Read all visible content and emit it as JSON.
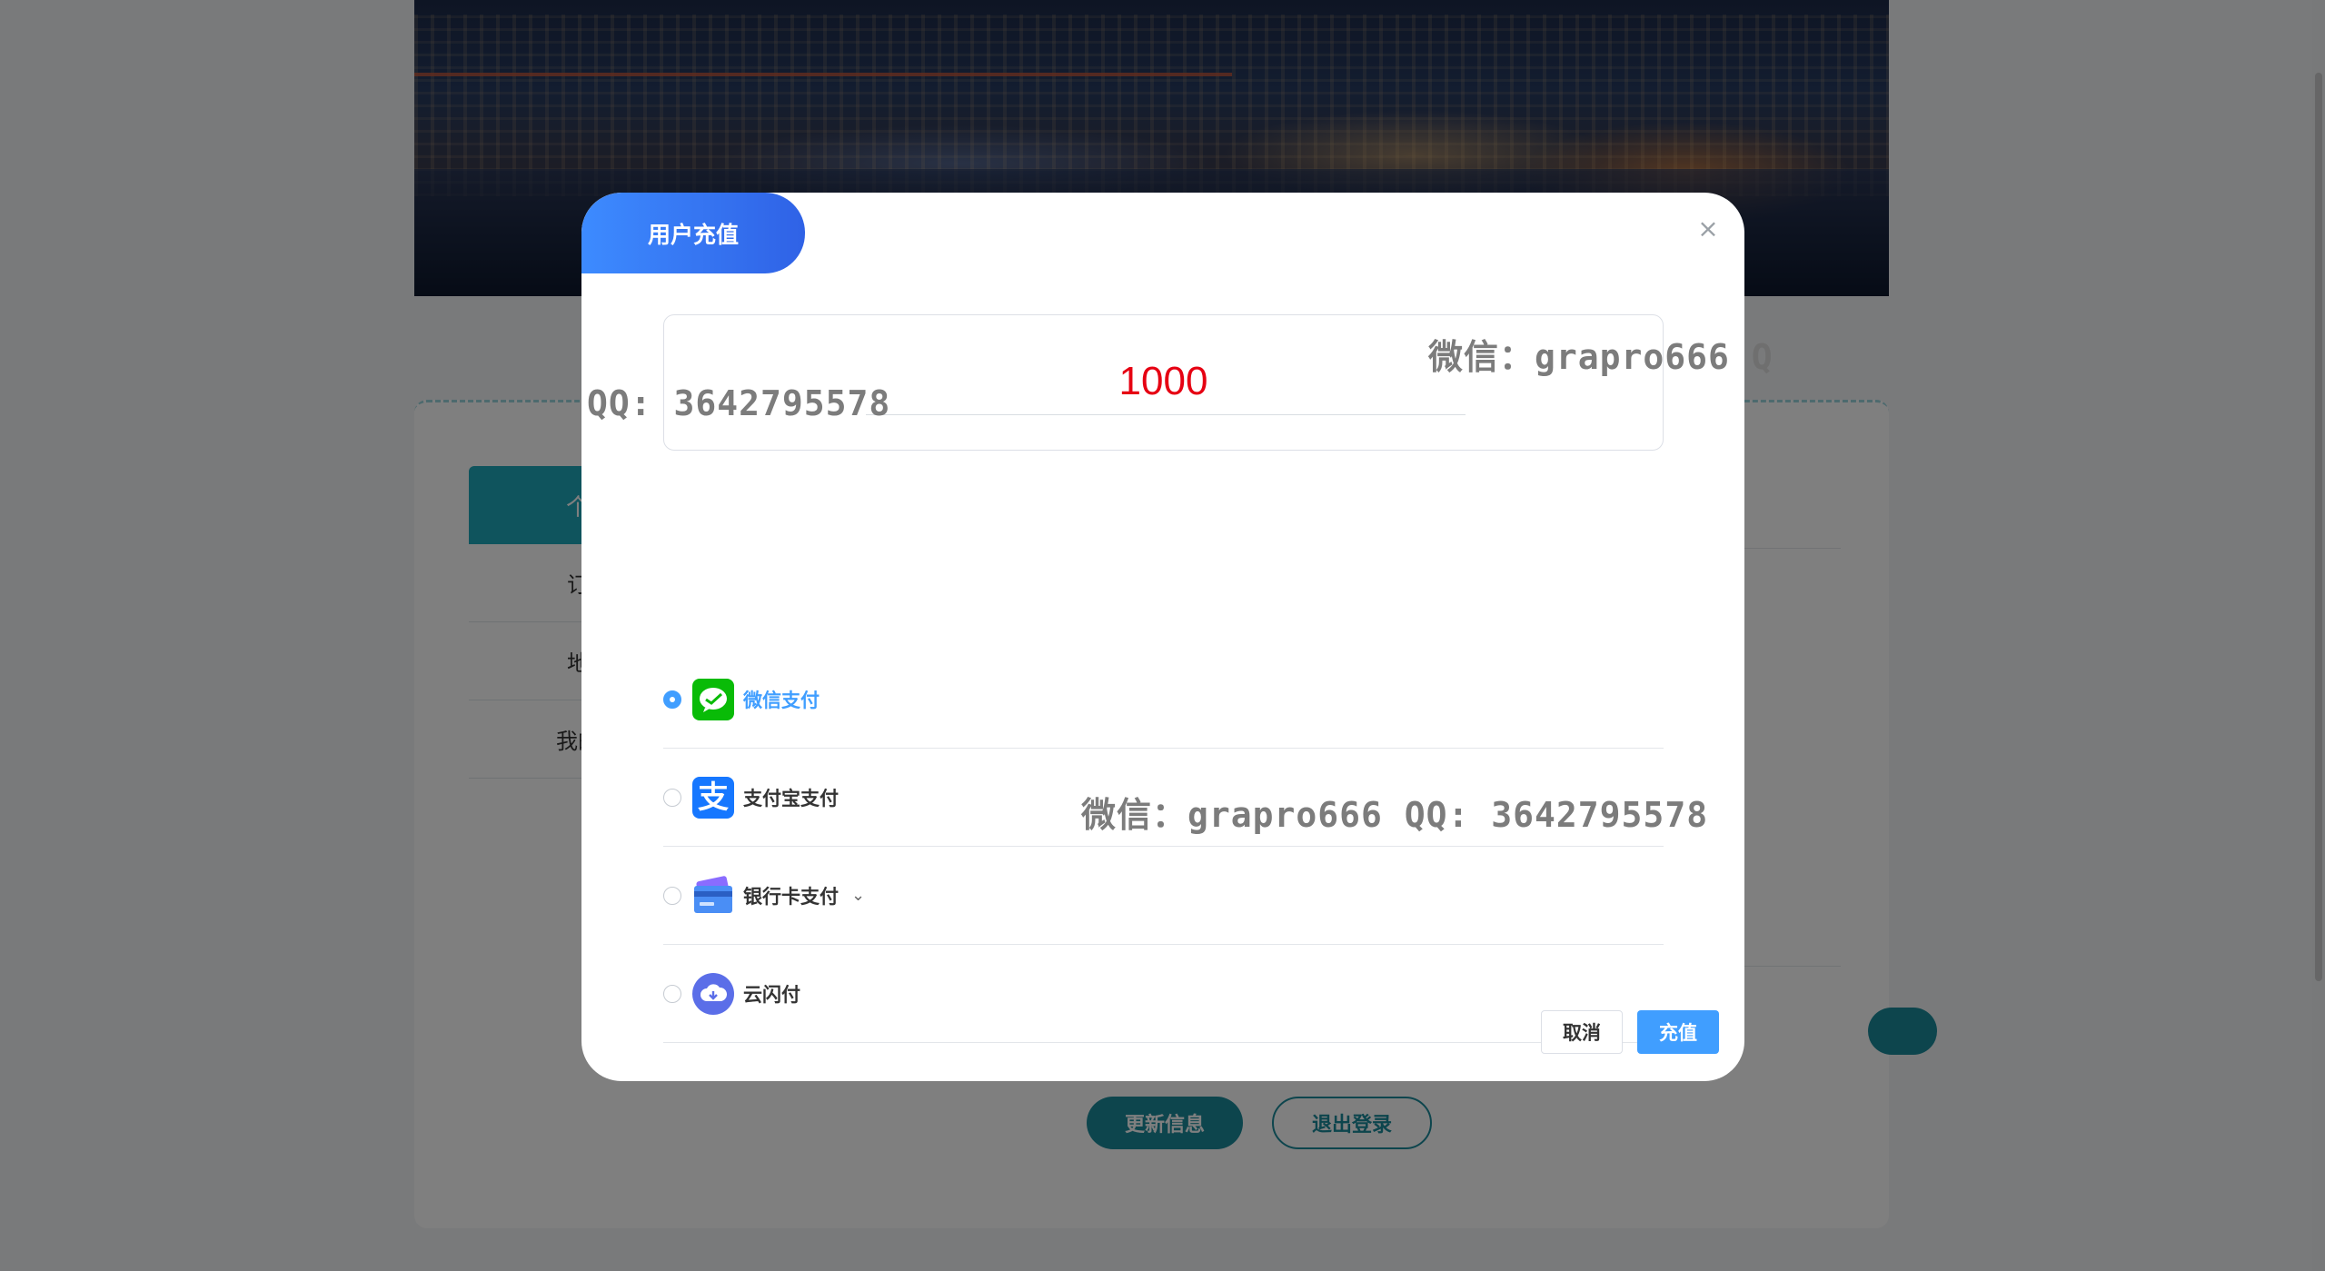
{
  "dialog": {
    "title": "用户充值",
    "amount": "1000",
    "payments": [
      {
        "label": "微信支付",
        "icon": "wechat-icon",
        "selected": true
      },
      {
        "label": "支付宝支付",
        "icon": "alipay-icon",
        "glyph": "支",
        "selected": false
      },
      {
        "label": "银行卡支付",
        "icon": "bank-card-icon",
        "selected": false
      },
      {
        "label": "云闪付",
        "icon": "cloud-pay-icon",
        "selected": false
      }
    ],
    "cancel": "取消",
    "confirm": "充值"
  },
  "background": {
    "sidebar": [
      "个",
      "订",
      "地",
      "我的"
    ],
    "update_btn": "更新信息",
    "logout_btn": "退出登录",
    "footer": ""
  },
  "watermarks": [
    "微信：grapro666 Q",
    "QQ: 3642795578",
    "微信：grapro666 QQ: 3642795578"
  ],
  "colors": {
    "accent": "#409eff",
    "title_gradient_start": "#3d8bff",
    "title_gradient_end": "#2f62e6",
    "amount": "#e60012",
    "theme": "#1b8a9a",
    "wechat": "#09bb07",
    "alipay": "#1677ff"
  }
}
